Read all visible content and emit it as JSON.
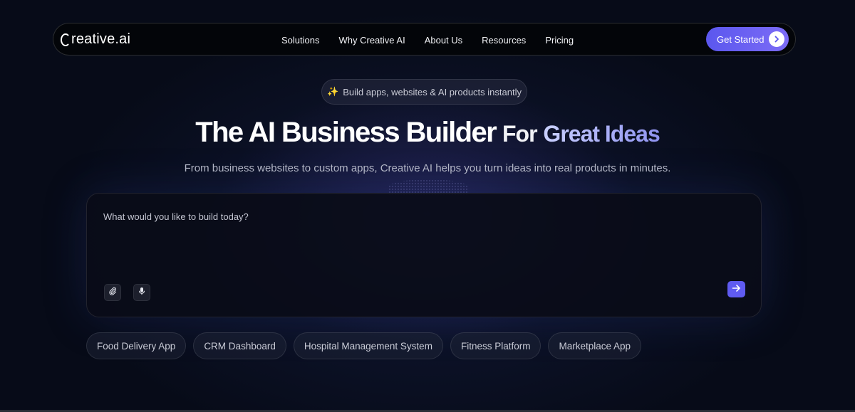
{
  "brand": {
    "name": "reative.ai",
    "icon": "c-ring-logo"
  },
  "nav": {
    "links": [
      "Solutions",
      "Why Creative AI",
      "About Us",
      "Resources",
      "Pricing"
    ],
    "cta_label": "Get Started"
  },
  "hero": {
    "badge": "Build apps, websites & AI products instantly",
    "badge_icon": "sparkle-icon",
    "title_main": "The AI Business Builder",
    "title_for": "For",
    "title_accent": "Great Ideas",
    "subtitle": "From business websites to custom apps, Creative AI helps you turn ideas into real products in minutes."
  },
  "prompt": {
    "placeholder": "What would you like to build today?",
    "attach_icon": "paperclip-icon",
    "mic_icon": "microphone-icon",
    "send_icon": "arrow-right-icon"
  },
  "suggestions": [
    "Food Delivery App",
    "CRM Dashboard",
    "Hospital Management System",
    "Fitness Platform",
    "Marketplace App"
  ],
  "colors": {
    "background": "#070b18",
    "accent": "#5f5bf1",
    "accent_light": "#8f93f0"
  }
}
